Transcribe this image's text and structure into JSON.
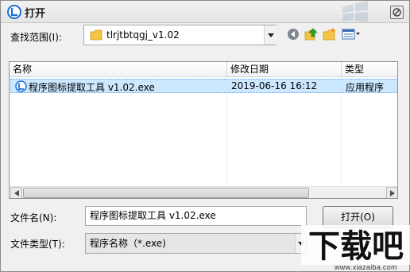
{
  "window": {
    "title": "打开"
  },
  "lookin": {
    "label": "查找范围(I):",
    "value": "tlrjtbtqgj_v1.02"
  },
  "toolbar": {
    "icons": [
      "back-icon",
      "up-folder-icon",
      "new-folder-icon",
      "view-menu-icon"
    ]
  },
  "filelist": {
    "columns": [
      "名称",
      "修改日期",
      "类型"
    ],
    "rows": [
      {
        "name": "程序图标提取工具 v1.02.exe",
        "date": "2019-06-16 16:12",
        "type": "应用程序"
      }
    ]
  },
  "filename": {
    "label": "文件名(N):",
    "value": "程序图标提取工具 v1.02.exe"
  },
  "filetype": {
    "label": "文件类型(T):",
    "value": "程序名称（*.exe)"
  },
  "buttons": {
    "open": "打开(O)"
  },
  "watermark": {
    "logo_text": "下载吧",
    "url": "www.xiazaiba.com"
  },
  "colors": {
    "selection": "#cce8ff",
    "folder": "#f5c542",
    "app_icon": "#1e6fd9"
  }
}
